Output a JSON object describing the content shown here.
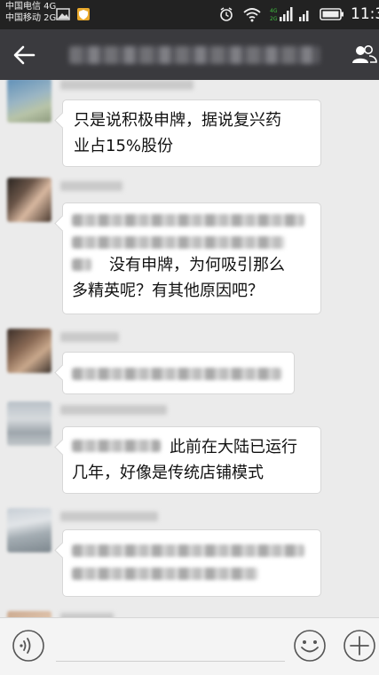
{
  "status_bar": {
    "carrier_1": "中国电信 4G",
    "carrier_2": "中国移动 2G",
    "time": "11:3"
  },
  "header": {
    "back_icon": "arrow-left-icon",
    "members_icon": "group-members-icon"
  },
  "messages": [
    {
      "lines": [
        "只是说积极申牌，据说复兴药",
        "业占15%股份"
      ]
    },
    {
      "lines": [
        "没有申牌，为何吸引那么",
        "多精英呢？有其他原因吧？"
      ]
    },
    {
      "lines": []
    },
    {
      "lines": [
        "此前在大陆已运行",
        "几年，好像是传统店铺模式"
      ]
    },
    {
      "lines": []
    }
  ],
  "input_bar": {
    "voice_icon": "voice-icon",
    "emoji_icon": "emoji-icon",
    "plus_icon": "plus-icon",
    "placeholder": ""
  },
  "colors": {
    "title_bar": "#3a3a3e",
    "status_bar": "#222222",
    "chat_bg": "#ebebeb",
    "bubble": "#ffffff"
  }
}
